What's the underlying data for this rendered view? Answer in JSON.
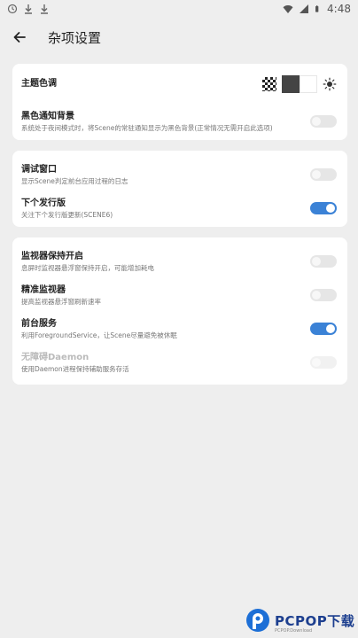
{
  "status_bar": {
    "time": "4:48",
    "left_icons": [
      "clock-icon",
      "download-icon",
      "download-icon"
    ],
    "right_icons": [
      "wifi-icon",
      "signal-icon",
      "battery-icon"
    ]
  },
  "header": {
    "title": "杂项设置",
    "back_icon": "arrow-left-icon"
  },
  "cards": [
    {
      "rows": [
        {
          "title": "主题色调",
          "type": "theme"
        },
        {
          "title": "黑色通知背景",
          "subtitle": "系统处于夜间模式时，将Scene的常驻通知显示为黑色背景(正常情况无需开启此选项)",
          "switch": "off"
        }
      ]
    },
    {
      "rows": [
        {
          "title": "调试窗口",
          "subtitle": "显示Scene判定前台应用过程的日志",
          "switch": "off"
        },
        {
          "title": "下个发行版",
          "subtitle": "关注下个发行版更新(SCENE6)",
          "switch": "on"
        }
      ]
    },
    {
      "rows": [
        {
          "title": "监视器保持开启",
          "subtitle": "息屏时监视器悬浮窗保持开启，可能增加耗电",
          "switch": "off"
        },
        {
          "title": "精准监视器",
          "subtitle": "提高监视器悬浮窗刷新速率",
          "switch": "off"
        },
        {
          "title": "前台服务",
          "subtitle": "利用ForegroundService，让Scene尽量避免被休眠",
          "switch": "on"
        },
        {
          "title": "无障碍Daemon",
          "subtitle": "使用Daemon进程保持辅助服务存活",
          "switch": "disabled"
        }
      ]
    }
  ],
  "colors": {
    "accent": "#3b82d6",
    "background": "#eeeeee",
    "card": "#ffffff"
  },
  "watermark": {
    "text": "PCPOP下载",
    "subtext": "PCPOP.Download"
  }
}
